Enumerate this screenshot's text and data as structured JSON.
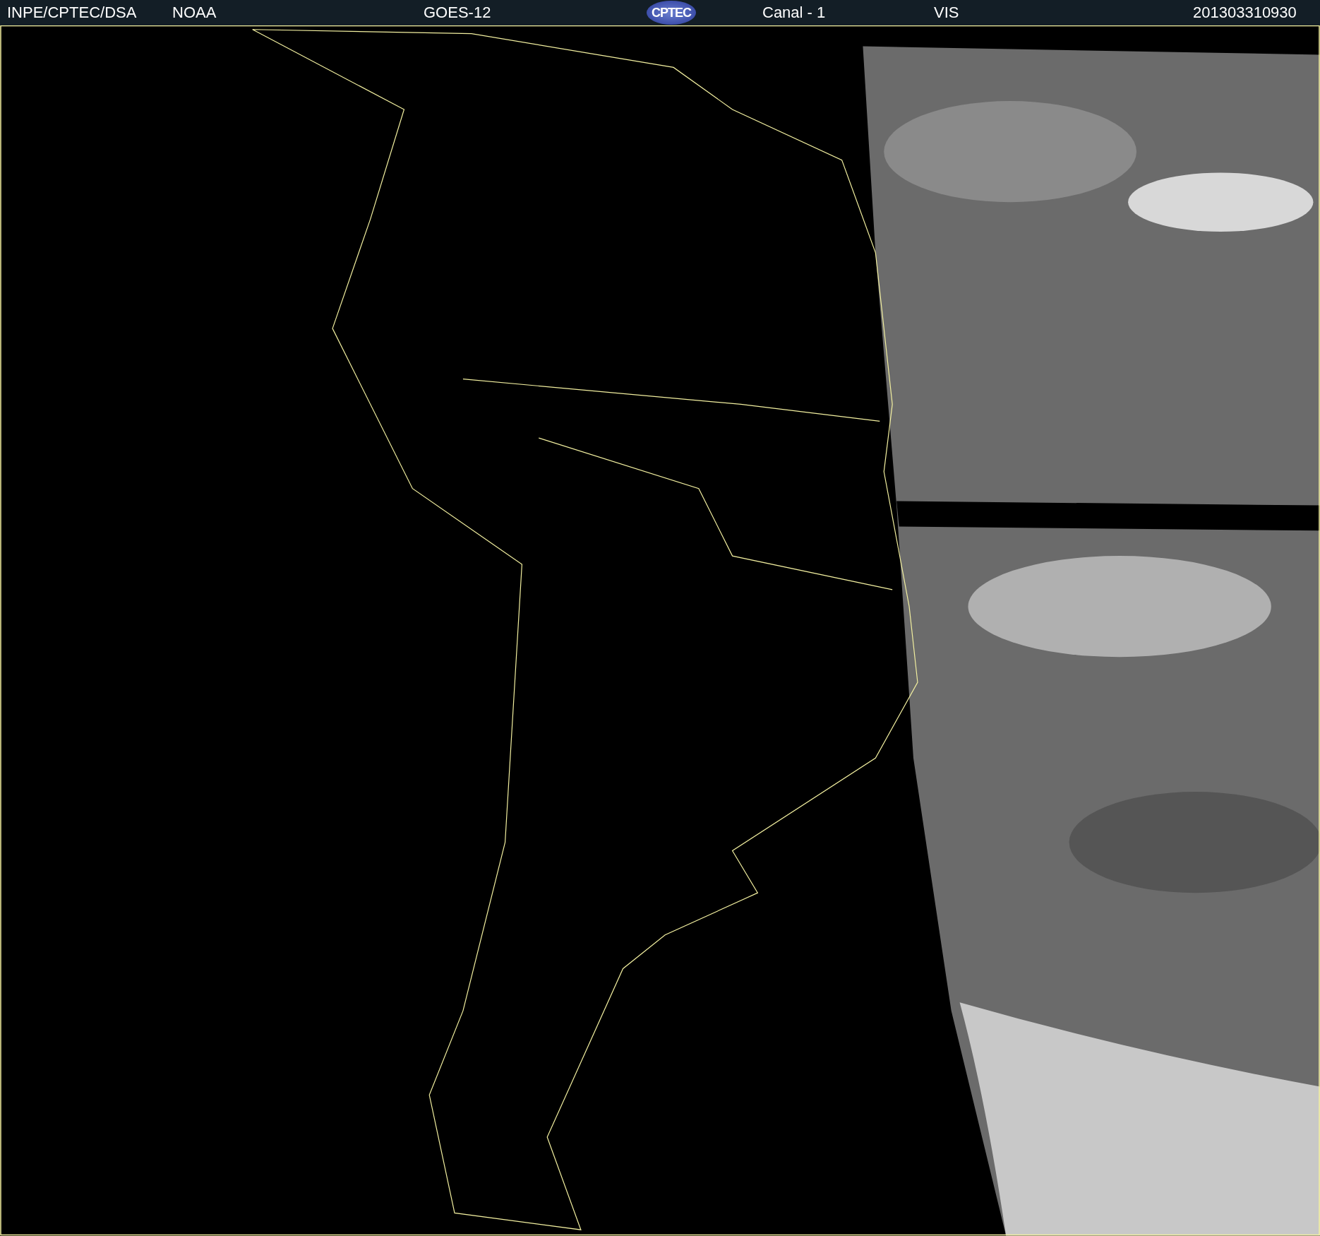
{
  "header": [
    {
      "kind": "text",
      "text": "INPE/CPTEC/DSA"
    },
    {
      "kind": "text",
      "text": "NOAA"
    },
    {
      "kind": "text",
      "text": "GOES-12"
    },
    {
      "kind": "logo",
      "text": "CPTEC"
    },
    {
      "kind": "text",
      "text": "Canal - 1"
    },
    {
      "kind": "text",
      "text": "VIS"
    },
    {
      "kind": "text",
      "text": "201303310930"
    }
  ]
}
